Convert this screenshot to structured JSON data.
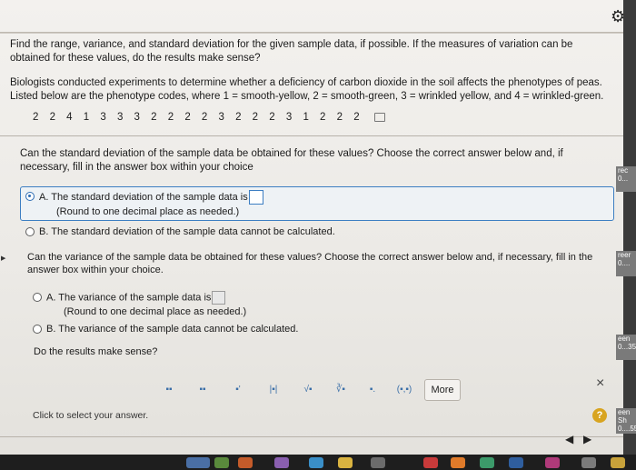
{
  "header": {
    "gear_icon": "gear-icon"
  },
  "question": {
    "instructions": "Find the range, variance, and standard deviation for the given sample data, if possible. If the measures of variation can be obtained for these values, do the results make sense?",
    "scenario": "Biologists conducted experiments to determine whether a deficiency of carbon dioxide in the soil affects the phenotypes of peas. Listed below are the phenotype codes, where 1 = smooth-yellow, 2 = smooth-green, 3 = wrinkled yellow, and 4 = wrinkled-green.",
    "data_values": "2 2 4 1 3 3 3 2 2 2 2 3 2 2 2 3 1 2 2 2"
  },
  "part1": {
    "prompt": "Can the standard deviation of the sample data be obtained for these values? Choose the correct answer below and, if necessary, fill in the answer box within your choice",
    "optionA_label": "A.",
    "optionA_text": "The standard deviation of the sample data is",
    "optionA_note": "(Round to one decimal place as needed.)",
    "optionB_label": "B.",
    "optionB_text": "The standard deviation of the sample data cannot be calculated."
  },
  "part2": {
    "prompt": "Can the variance of the sample data be obtained for these values? Choose the correct answer below and, if necessary, fill in the answer box within your choice.",
    "optionA_label": "A.",
    "optionA_text": "The variance of the sample data is",
    "optionA_note": "(Round to one decimal place as needed.)",
    "optionB_label": "B.",
    "optionB_text": "The variance of the sample data cannot be calculated."
  },
  "part3": {
    "prompt": "Do the results make sense?"
  },
  "toolbar": {
    "more_label": "More",
    "close_label": "×",
    "buttons": [
      "▪▪",
      "▪▪",
      "▪'",
      "|▪|",
      "√▪",
      "∛▪",
      "▪.",
      "(▪,▪)"
    ]
  },
  "footer": {
    "hint": "Click to select your answer.",
    "help_label": "?",
    "prev_label": "◀",
    "next_label": "▶"
  },
  "side_tabs": [
    "rec 0...",
    "reer 0....",
    "een 0...35",
    "een Sh 0....55."
  ],
  "colors": {
    "accent": "#3c7ec2",
    "help": "#d8a420"
  }
}
